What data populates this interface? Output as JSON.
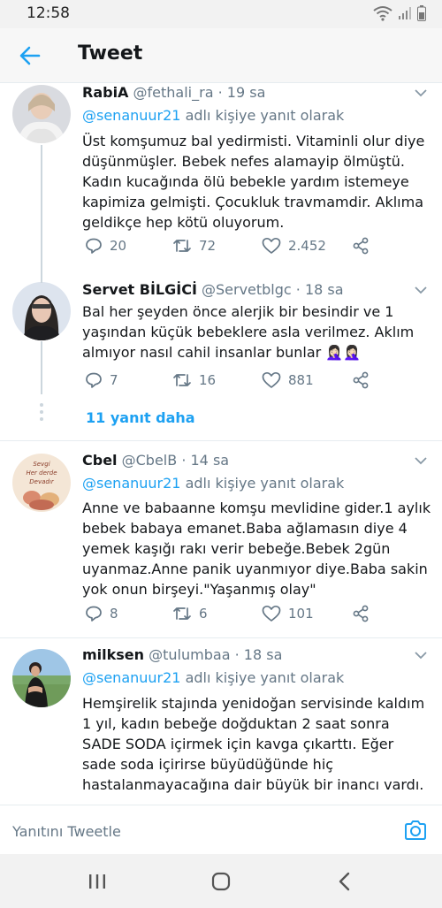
{
  "status": {
    "time": "12:58"
  },
  "header": {
    "title": "Tweet"
  },
  "tweets": [
    {
      "name": "RabiA",
      "handle": "@fethali_ra",
      "time": "19 sa",
      "reply_prefix": "@senanuur21",
      "reply_suffix": " adlı kişiye yanıt olarak",
      "text": "Üst komşumuz bal yedirmisti. Vitaminli olur diye düşünmüşler. Bebek nefes alamayip ölmüştü. Kadın kucağında ölü bebekle yardım istemeye kapimiza gelmişti. Çocukluk travmamdir. Aklıma geldikçe hep kötü oluyorum.",
      "replies": "20",
      "retweets": "72",
      "likes": "2.452"
    },
    {
      "name": "Servet BİLGİCİ",
      "handle": "@Servetblgc",
      "time": "18 sa",
      "reply_prefix": "",
      "reply_suffix": "",
      "text": "Bal her şeyden önce alerjik bir besindir ve 1 yaşından küçük bebeklere asla verilmez. Aklım almıyor nasıl cahil insanlar bunlar 🤦🏻‍♀️🤦🏻‍♀️",
      "replies": "7",
      "retweets": "16",
      "likes": "881"
    },
    {
      "name": "Cbel",
      "handle": "@CbelB",
      "time": "14 sa",
      "reply_prefix": "@senanuur21",
      "reply_suffix": " adlı kişiye yanıt olarak",
      "text": "Anne ve babaanne komşu mevlidine gider.1 aylık bebek babaya emanet.Baba ağlamasın diye 4 yemek kaşığı rakı verir bebeğe.Bebek 2gün uyanmaz.Anne panik uyanmıyor diye.Baba sakin yok onun birşeyi.\"Yaşanmış olay\"",
      "replies": "8",
      "retweets": "6",
      "likes": "101"
    },
    {
      "name": "milksen",
      "handle": "@tulumbaa",
      "time": "18 sa",
      "reply_prefix": "@senanuur21",
      "reply_suffix": " adlı kişiye yanıt olarak",
      "text": "Hemşirelik stajında yenidoğan servisinde kaldım 1 yıl, kadın bebeğe doğduktan 2 saat sonra SADE SODA içirmek için kavga çıkarttı. Eğer sade soda içirirse büyüdüğünde hiç hastalanmayacağına dair büyük bir inancı vardı.",
      "replies": "",
      "retweets": "",
      "likes": ""
    }
  ],
  "thread": {
    "more_replies": "11 yanıt daha"
  },
  "avatars": {
    "cbel_caption_1": "Sevgi",
    "cbel_caption_2": "Her derde",
    "cbel_caption_3": "Devadır"
  },
  "composer": {
    "placeholder": "Yanıtını Tweetle"
  },
  "colors": {
    "accent": "#1da1f2",
    "text": "#14171a",
    "muted": "#657786",
    "divider": "#e6ecf0"
  },
  "icons": [
    "wifi-icon",
    "signal-icon",
    "battery-icon",
    "back-arrow-icon",
    "chevron-down-icon",
    "reply-icon",
    "retweet-icon",
    "like-icon",
    "share-icon",
    "camera-icon",
    "recents-icon",
    "home-icon",
    "nav-back-icon"
  ]
}
